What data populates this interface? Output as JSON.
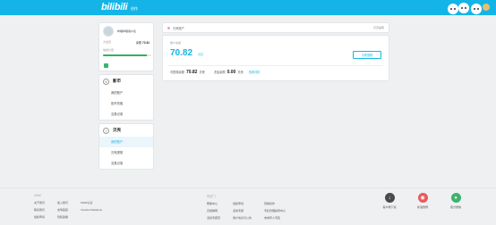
{
  "header": {
    "logo": "bilibili",
    "logo_sub": "创作"
  },
  "profile": {
    "username": "哔哩哔哩用户名",
    "level_label": "大会员",
    "balance_label": "余额",
    "balance_value": "70.82",
    "credit_label": "信用分值",
    "progress_percent": 90
  },
  "menus": [
    {
      "title": "影币",
      "icon": "coin",
      "items": [
        "我的账户",
        "影币充值",
        "交易记录"
      ],
      "active": -1
    },
    {
      "title": "贝壳",
      "icon": "shell",
      "items": [
        "我的账户",
        "贝壳提现",
        "交易记录"
      ],
      "active": 0
    }
  ],
  "breadcrumb": {
    "label": "贝壳账户",
    "right": "贝壳提现"
  },
  "balance": {
    "label": "账户余额",
    "value": "70.82",
    "unit": "贝壳",
    "withdraw_button": "贝壳提现",
    "available_label": "可提现余额",
    "available_value": "70.82",
    "available_unit": "贝壳",
    "frozen_label": "冻结余额",
    "frozen_value": "0.00",
    "frozen_unit": "贝壳",
    "link": "查看详情"
  },
  "footer": {
    "col1": {
      "head": "bilibili",
      "links": [
        "关于我们",
        "加入我们",
        "bilibili认证",
        "联系我们",
        "友情链接",
        "Investor Relations",
        "侵权申诉",
        "隐私政策",
        ""
      ]
    },
    "col2": {
      "head": "传送门",
      "links": [
        "帮助中心",
        "侵权申诉",
        "营销合作",
        "高级弹幕",
        "活动专题",
        "专栏管理指导中心",
        "活动专题页",
        "用户协议与公约",
        "未成年人专区"
      ]
    },
    "apps": [
      {
        "label": "客户端下载",
        "icon": "download-icon",
        "color": "#4a4a4a"
      },
      {
        "label": "新浪微博",
        "icon": "weibo-icon",
        "color": "#e85b5b"
      },
      {
        "label": "官方微信",
        "icon": "wechat-icon",
        "color": "#3bb36f"
      }
    ]
  }
}
